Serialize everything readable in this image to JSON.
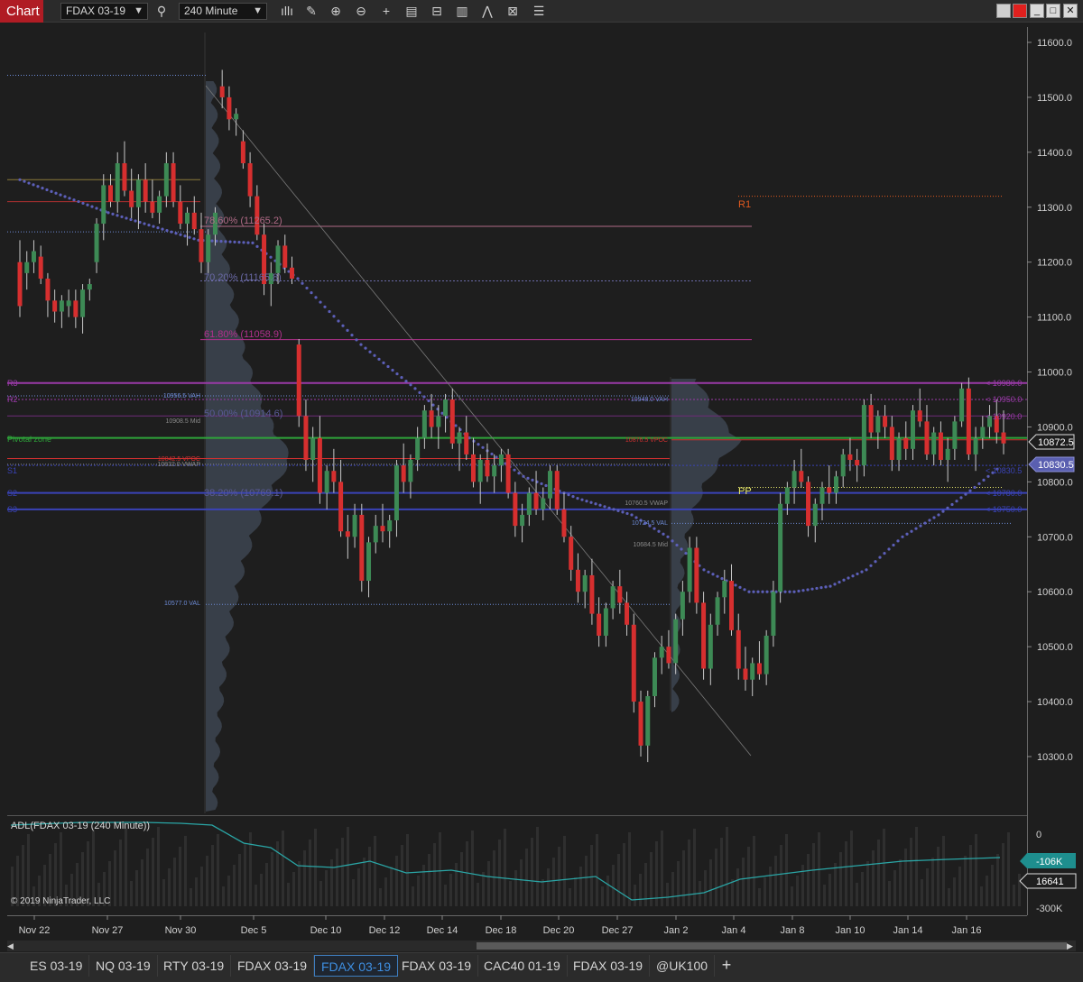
{
  "toolbar": {
    "chart_label": "Chart",
    "instrument": "FDAX 03-19",
    "interval": "240 Minute"
  },
  "price_axis": {
    "ticks": [
      "11600.0",
      "11500.0",
      "11400.0",
      "11300.0",
      "11200.0",
      "11100.0",
      "11000.0",
      "10900.0",
      "10800.0",
      "10700.0",
      "10600.0",
      "10500.0",
      "10400.0",
      "10300.0"
    ],
    "last_price": "10872.5",
    "ma_value": "10830.5",
    "last_color": "#ffffff",
    "ma_color": "#6a6fc0"
  },
  "time_axis": {
    "labels": [
      "Nov 22",
      "Nov 27",
      "Nov 30",
      "Dec 5",
      "Dec 10",
      "Dec 12",
      "Dec 14",
      "Dec 18",
      "Dec 20",
      "Dec 27",
      "Jan 2",
      "Jan 4",
      "Jan 8",
      "Jan 10",
      "Jan 14",
      "Jan 16"
    ]
  },
  "fib_labels": {
    "f786": "78.60% (11265.2)",
    "f702": "70.20% (11165.8)",
    "f618": "61.80% (11058.9)",
    "f5": "50.00% (10914.6)",
    "f382": "38.20% (10769.1)"
  },
  "pivots": {
    "r1": "R1",
    "pp": "PP",
    "r3": "R3",
    "r2": "R2",
    "pivotal_zone": "Pivotal zone",
    "s1": "S1",
    "s2": "S2",
    "s3": "S3",
    "right_r3": "< 10980.0",
    "right_r2": "< 10950.0",
    "right_r1": "< 10920.0",
    "right_s1": "< 10830.5",
    "right_s2": "< 10780.0",
    "right_s3": "< 10750.0"
  },
  "profile_labels": {
    "vah1": "10956.5 VAH",
    "mid1": "10908.5 Mid",
    "vpoc1": "10842.5 VPOC",
    "vwap1": "10832.0 VWAP",
    "val1": "10577.0 VAL",
    "vah2": "10948.0 VAH",
    "vpoc2": "10876.5 VPOC",
    "vwap2": "10760.5 VWAP",
    "val2": "10724.5 VAL",
    "mid2": "10684.5 Mid"
  },
  "indicator": {
    "title": "ADL(FDAX 03-19 (240 Minute))",
    "ticks": [
      "0",
      "-300K"
    ],
    "value": "-106K",
    "value2": "16641",
    "copyright": "© 2019 NinjaTrader, LLC"
  },
  "tabs": [
    "ES 03-19",
    "NQ 03-19",
    "RTY 03-19",
    "FDAX 03-19",
    "FDAX 03-19",
    "FDAX 03-19",
    "CAC40 01-19",
    "FDAX 03-19",
    "@UK100"
  ],
  "active_tab_index": 4,
  "chart_data": {
    "type": "candlestick",
    "ylim": [
      10250,
      11650
    ],
    "candles": [
      [
        11200,
        11240,
        11100,
        11120
      ],
      [
        11180,
        11220,
        11150,
        11200
      ],
      [
        11200,
        11240,
        11180,
        11220
      ],
      [
        11210,
        11230,
        11160,
        11170
      ],
      [
        11170,
        11180,
        11100,
        11130
      ],
      [
        11130,
        11150,
        11090,
        11110
      ],
      [
        11110,
        11140,
        11080,
        11130
      ],
      [
        11120,
        11150,
        11100,
        11130
      ],
      [
        11130,
        11150,
        11080,
        11100
      ],
      [
        11100,
        11160,
        11070,
        11150
      ],
      [
        11150,
        11170,
        11130,
        11160
      ],
      [
        11200,
        11280,
        11180,
        11270
      ],
      [
        11270,
        11360,
        11240,
        11340
      ],
      [
        11340,
        11360,
        11300,
        11310
      ],
      [
        11310,
        11400,
        11290,
        11380
      ],
      [
        11380,
        11420,
        11320,
        11330
      ],
      [
        11330,
        11370,
        11280,
        11300
      ],
      [
        11300,
        11360,
        11260,
        11350
      ],
      [
        11350,
        11380,
        11290,
        11310
      ],
      [
        11310,
        11350,
        11280,
        11290
      ],
      [
        11290,
        11330,
        11270,
        11320
      ],
      [
        11320,
        11400,
        11300,
        11380
      ],
      [
        11380,
        11400,
        11300,
        11310
      ],
      [
        11310,
        11340,
        11260,
        11270
      ],
      [
        11270,
        11300,
        11230,
        11290
      ],
      [
        11290,
        11320,
        11250,
        11260
      ],
      [
        11260,
        11290,
        11180,
        11200
      ],
      [
        11200,
        11260,
        11180,
        11250
      ],
      [
        11250,
        11300,
        11230,
        11290
      ],
      [
        11520,
        11550,
        11480,
        11500
      ],
      [
        11500,
        11520,
        11440,
        11460
      ],
      [
        11460,
        11480,
        11430,
        11470
      ],
      [
        11420,
        11440,
        11370,
        11380
      ],
      [
        11380,
        11400,
        11300,
        11320
      ],
      [
        11320,
        11340,
        11240,
        11250
      ],
      [
        11250,
        11270,
        11140,
        11160
      ],
      [
        11160,
        11200,
        11120,
        11180
      ],
      [
        11180,
        11240,
        11160,
        11230
      ],
      [
        11230,
        11250,
        11180,
        11190
      ],
      [
        11190,
        11210,
        11160,
        11170
      ],
      [
        11050,
        11060,
        10900,
        10920
      ],
      [
        10920,
        10950,
        10820,
        10840
      ],
      [
        10840,
        10900,
        10800,
        10880
      ],
      [
        10880,
        10920,
        10760,
        10780
      ],
      [
        10780,
        10830,
        10750,
        10820
      ],
      [
        10820,
        10860,
        10780,
        10800
      ],
      [
        10800,
        10840,
        10700,
        10710
      ],
      [
        10710,
        10740,
        10660,
        10700
      ],
      [
        10700,
        10760,
        10680,
        10740
      ],
      [
        10740,
        10760,
        10600,
        10620
      ],
      [
        10620,
        10700,
        10590,
        10690
      ],
      [
        10690,
        10740,
        10670,
        10720
      ],
      [
        10720,
        10760,
        10690,
        10710
      ],
      [
        10710,
        10740,
        10680,
        10730
      ],
      [
        10730,
        10840,
        10700,
        10830
      ],
      [
        10830,
        10870,
        10780,
        10800
      ],
      [
        10800,
        10850,
        10770,
        10840
      ],
      [
        10840,
        10900,
        10820,
        10880
      ],
      [
        10880,
        10940,
        10860,
        10930
      ],
      [
        10930,
        10960,
        10880,
        10900
      ],
      [
        10900,
        10940,
        10860,
        10920
      ],
      [
        10920,
        10960,
        10890,
        10950
      ],
      [
        10950,
        10970,
        10860,
        10870
      ],
      [
        10870,
        10900,
        10820,
        10890
      ],
      [
        10890,
        10920,
        10840,
        10850
      ],
      [
        10850,
        10880,
        10790,
        10800
      ],
      [
        10800,
        10850,
        10760,
        10840
      ],
      [
        10840,
        10870,
        10800,
        10810
      ],
      [
        10810,
        10850,
        10780,
        10830
      ],
      [
        10830,
        10860,
        10800,
        10850
      ],
      [
        10850,
        10860,
        10770,
        10780
      ],
      [
        10780,
        10800,
        10700,
        10720
      ],
      [
        10720,
        10760,
        10690,
        10740
      ],
      [
        10740,
        10790,
        10720,
        10780
      ],
      [
        10780,
        10820,
        10740,
        10750
      ],
      [
        10750,
        10790,
        10730,
        10770
      ],
      [
        10770,
        10830,
        10750,
        10820
      ],
      [
        10820,
        10830,
        10740,
        10750
      ],
      [
        10750,
        10780,
        10690,
        10700
      ],
      [
        10700,
        10720,
        10620,
        10640
      ],
      [
        10640,
        10670,
        10580,
        10600
      ],
      [
        10600,
        10640,
        10570,
        10630
      ],
      [
        10630,
        10660,
        10540,
        10560
      ],
      [
        10560,
        10590,
        10500,
        10520
      ],
      [
        10520,
        10580,
        10500,
        10570
      ],
      [
        10570,
        10620,
        10550,
        10610
      ],
      [
        10610,
        10640,
        10560,
        10580
      ],
      [
        10580,
        10600,
        10520,
        10540
      ],
      [
        10540,
        10560,
        10380,
        10400
      ],
      [
        10400,
        10420,
        10300,
        10320
      ],
      [
        10320,
        10420,
        10290,
        10410
      ],
      [
        10410,
        10490,
        10390,
        10480
      ],
      [
        10480,
        10520,
        10450,
        10500
      ],
      [
        10500,
        10530,
        10460,
        10470
      ],
      [
        10470,
        10560,
        10450,
        10550
      ],
      [
        10550,
        10620,
        10520,
        10600
      ],
      [
        10600,
        10700,
        10580,
        10680
      ],
      [
        10680,
        10700,
        10560,
        10580
      ],
      [
        10580,
        10600,
        10440,
        10460
      ],
      [
        10460,
        10560,
        10430,
        10540
      ],
      [
        10540,
        10600,
        10520,
        10590
      ],
      [
        10590,
        10640,
        10560,
        10620
      ],
      [
        10620,
        10650,
        10520,
        10530
      ],
      [
        10530,
        10560,
        10440,
        10460
      ],
      [
        10460,
        10500,
        10420,
        10440
      ],
      [
        10440,
        10480,
        10410,
        10470
      ],
      [
        10470,
        10510,
        10440,
        10450
      ],
      [
        10450,
        10530,
        10430,
        10520
      ],
      [
        10520,
        10620,
        10500,
        10600
      ],
      [
        10600,
        10780,
        10580,
        10760
      ],
      [
        10760,
        10800,
        10740,
        10790
      ],
      [
        10790,
        10840,
        10760,
        10820
      ],
      [
        10820,
        10860,
        10790,
        10800
      ],
      [
        10800,
        10810,
        10700,
        10720
      ],
      [
        10720,
        10770,
        10690,
        10760
      ],
      [
        10760,
        10800,
        10730,
        10790
      ],
      [
        10790,
        10830,
        10760,
        10780
      ],
      [
        10780,
        10820,
        10760,
        10810
      ],
      [
        10810,
        10860,
        10790,
        10850
      ],
      [
        10850,
        10880,
        10820,
        10840
      ],
      [
        10840,
        10860,
        10800,
        10830
      ],
      [
        10830,
        10950,
        10810,
        10940
      ],
      [
        10940,
        10960,
        10880,
        10890
      ],
      [
        10890,
        10930,
        10860,
        10920
      ],
      [
        10920,
        10940,
        10880,
        10900
      ],
      [
        10900,
        10920,
        10820,
        10840
      ],
      [
        10840,
        10890,
        10820,
        10880
      ],
      [
        10880,
        10910,
        10840,
        10860
      ],
      [
        10860,
        10940,
        10840,
        10930
      ],
      [
        10930,
        10970,
        10900,
        10910
      ],
      [
        10910,
        10940,
        10840,
        10850
      ],
      [
        10850,
        10900,
        10830,
        10890
      ],
      [
        10890,
        10910,
        10830,
        10840
      ],
      [
        10840,
        10880,
        10800,
        10860
      ],
      [
        10860,
        10920,
        10840,
        10910
      ],
      [
        10910,
        10980,
        10900,
        10970
      ],
      [
        10970,
        10990,
        10840,
        10850
      ],
      [
        10850,
        10900,
        10820,
        10880
      ],
      [
        10880,
        10920,
        10860,
        10900
      ],
      [
        10900,
        10940,
        10880,
        10920
      ],
      [
        10920,
        10950,
        10870,
        10890
      ],
      [
        10890,
        10930,
        10850,
        10870
      ]
    ]
  }
}
